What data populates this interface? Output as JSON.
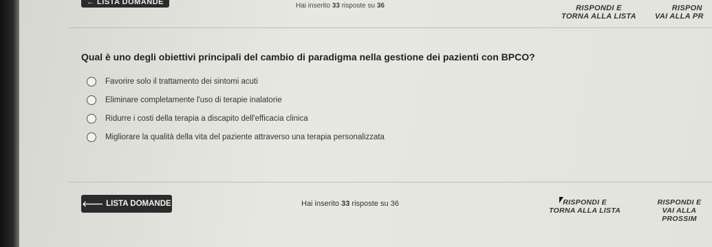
{
  "topbar": {
    "back_label": "← LISTA DOMANDE",
    "progress_prefix": "Hai inserito",
    "progress_answered": "33",
    "progress_mid": "risposte su",
    "progress_total": "36",
    "list_line1": "RISPONDI E",
    "list_line2": "TORNA ALLA LISTA",
    "next_line1": "RISPON",
    "next_line2": "VAI ALLA PR"
  },
  "question": {
    "text": "Qual è uno degli obiettivi principali del cambio di paradigma nella gestione dei pazienti con BPCO?",
    "options": [
      "Favorire solo il trattamento dei sintomi acuti",
      "Eliminare completamente l'uso di terapie inalatorie",
      "Ridurre i costi della terapia a discapito dell'efficacia clinica",
      "Migliorare la qualità della vita del paziente attraverso una terapia personalizzata"
    ]
  },
  "bottombar": {
    "back_icon": "arrow-left-icon",
    "back_label": "LISTA DOMANDE",
    "progress_prefix": "Hai inserito",
    "progress_answered": "33",
    "progress_mid": "risposte su",
    "progress_total": "36",
    "list_line1": "RISPONDI E",
    "list_line2": "TORNA ALLA LISTA",
    "next_line1": "RISPONDI E",
    "next_line2": "VAI ALLA PROSSIM"
  },
  "colors": {
    "button_dark": "#2b2b2b",
    "background": "#e4e5de"
  }
}
